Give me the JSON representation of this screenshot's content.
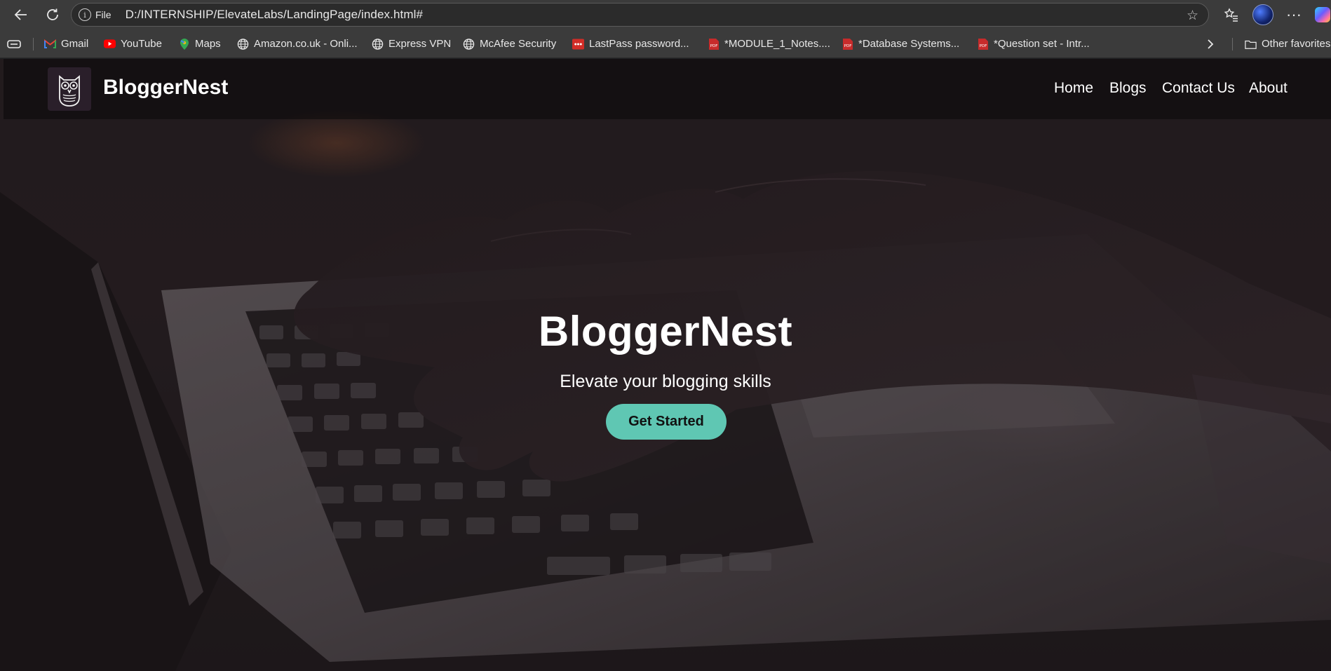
{
  "browser": {
    "omnibox_label": "File",
    "url": "D:/INTERNSHIP/ElevateLabs/LandingPage/index.html#",
    "icons": [
      "back-icon",
      "refresh-icon",
      "info-icon",
      "star-icon",
      "favorites-icon",
      "profile-avatar",
      "more-icon",
      "copilot-icon"
    ]
  },
  "bookmarks": [
    {
      "label": "Gmail",
      "icon": "gmail-icon"
    },
    {
      "label": "YouTube",
      "icon": "youtube-icon"
    },
    {
      "label": "Maps",
      "icon": "maps-icon"
    },
    {
      "label": "Amazon.co.uk - Onli...",
      "icon": "globe-icon"
    },
    {
      "label": "Express VPN",
      "icon": "globe-icon"
    },
    {
      "label": "McAfee Security",
      "icon": "globe-icon"
    },
    {
      "label": "LastPass password...",
      "icon": "lastpass-icon"
    },
    {
      "label": "*MODULE_1_Notes....",
      "icon": "pdf-icon"
    },
    {
      "label": "*Database Systems...",
      "icon": "pdf-icon"
    },
    {
      "label": "*Question set - Intr...",
      "icon": "pdf-icon"
    }
  ],
  "bookmarks_other": "Other favorites",
  "site": {
    "brand": "BloggerNest",
    "nav": [
      "Home",
      "Blogs",
      "Contact Us",
      "About"
    ],
    "hero_title": "BloggerNest",
    "hero_subtitle": "Elevate your blogging skills",
    "cta_label": "Get Started",
    "accent_color": "#5fc7b3"
  }
}
